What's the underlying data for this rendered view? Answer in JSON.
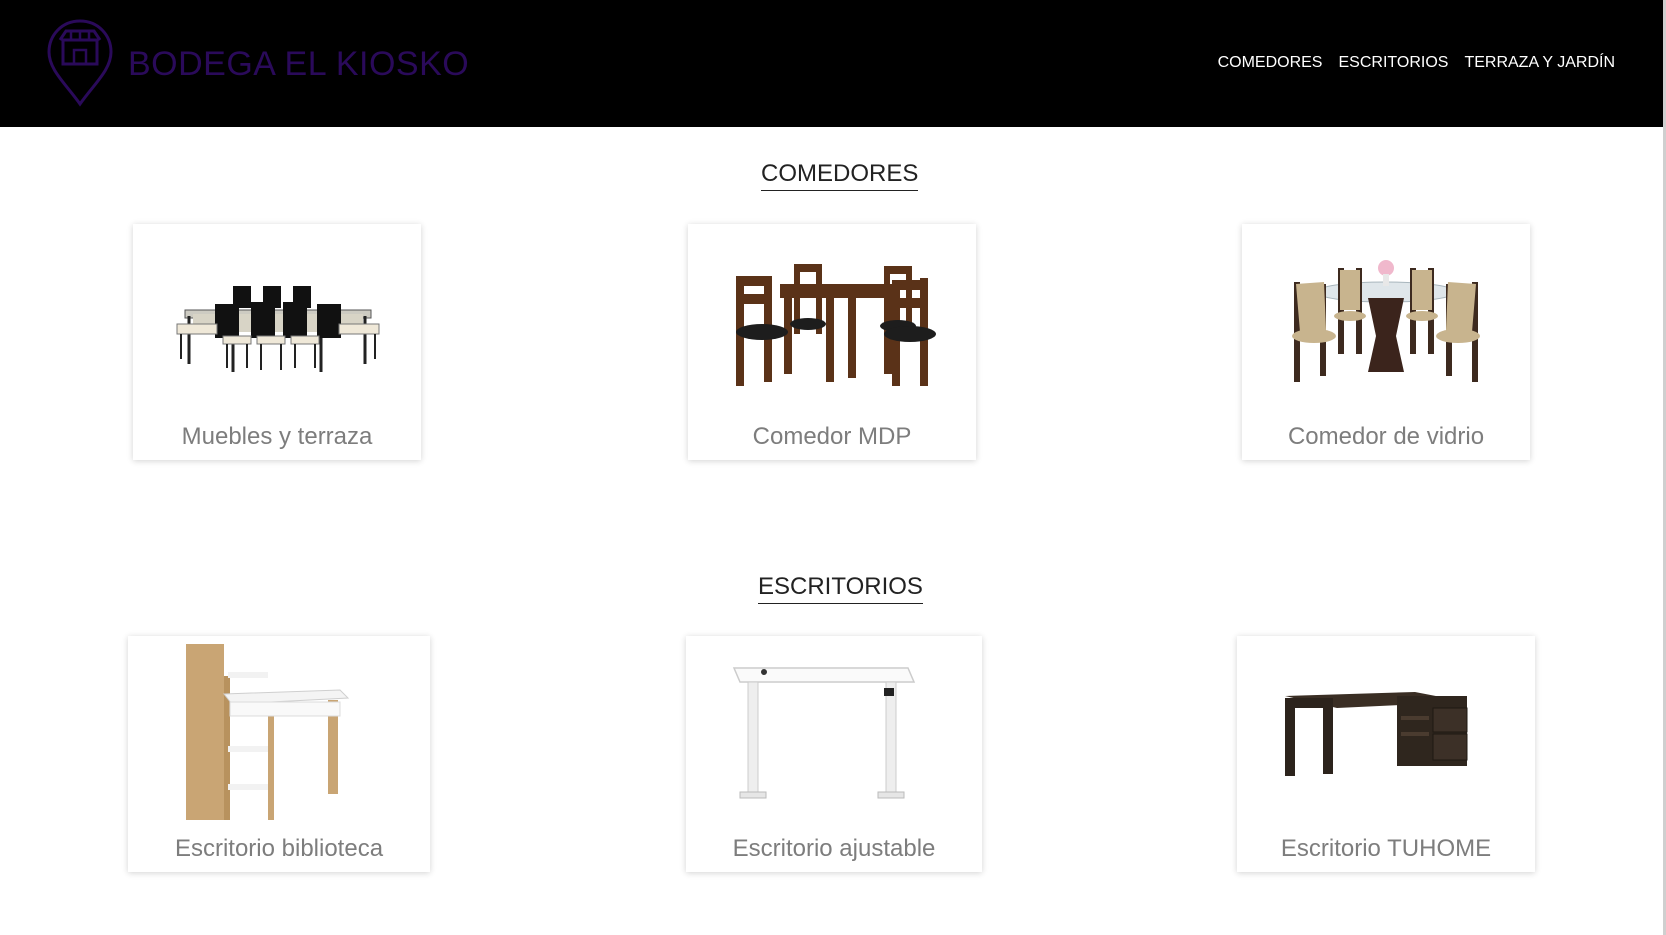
{
  "header": {
    "brand": "BODEGA EL KIOSKO",
    "logo_icon": "store-location-pin-icon",
    "nav": [
      "COMEDORES",
      "ESCRITORIOS",
      "TERRAZA Y JARDÍN"
    ]
  },
  "colors": {
    "header_bg": "#000000",
    "brand": "#2a0a5a",
    "nav_text": "#ffffff",
    "card_label": "#7d7d7d"
  },
  "sections": [
    {
      "title": "COMEDORES",
      "cards": [
        {
          "label": "Muebles y terraza",
          "image": "outdoor-dining-set-image"
        },
        {
          "label": "Comedor MDP",
          "image": "wooden-dining-set-image"
        },
        {
          "label": "Comedor de vidrio",
          "image": "glass-dining-set-image"
        }
      ]
    },
    {
      "title": "ESCRITORIOS",
      "cards": [
        {
          "label": "Escritorio biblioteca",
          "image": "bookshelf-desk-image"
        },
        {
          "label": "Escritorio ajustable",
          "image": "standing-desk-image"
        },
        {
          "label": "Escritorio TUHOME",
          "image": "l-shaped-desk-image"
        }
      ]
    }
  ]
}
